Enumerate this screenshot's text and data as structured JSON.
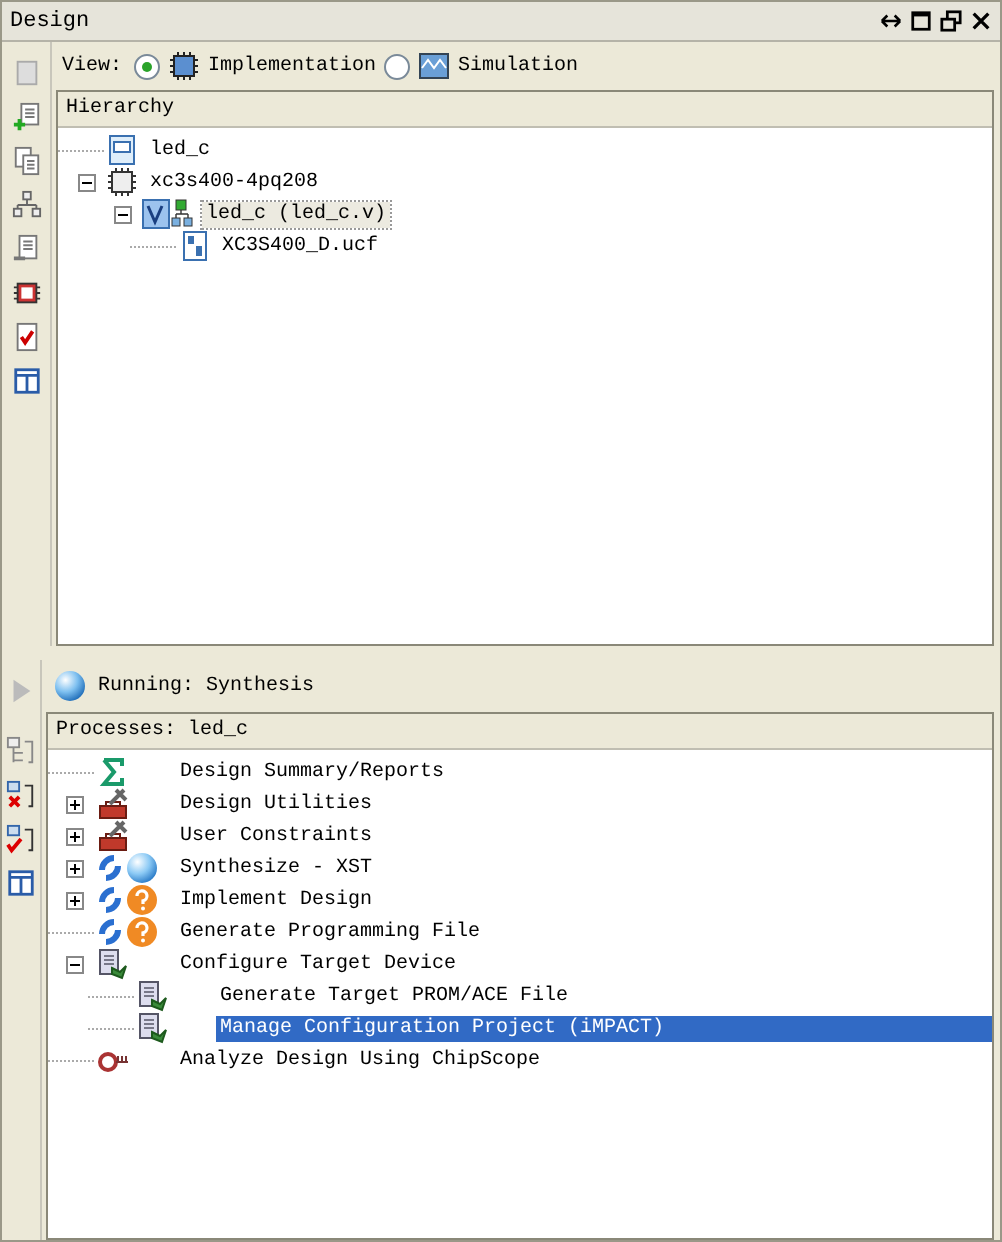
{
  "panel": {
    "title": "Design"
  },
  "view": {
    "label": "View:",
    "options": [
      {
        "label": "Implementation",
        "kind": "implementation",
        "selected": true
      },
      {
        "label": "Simulation",
        "kind": "simulation",
        "selected": false
      }
    ]
  },
  "hierarchy": {
    "header": "Hierarchy",
    "items": [
      {
        "label": "led_c",
        "kind": "project",
        "selected": false
      },
      {
        "label": "xc3s400-4pq208",
        "kind": "chip",
        "selected": false,
        "expanded": true,
        "children": [
          {
            "label": "led_c (led_c.v)",
            "kind": "verilog",
            "selected": true,
            "expanded": true,
            "children": [
              {
                "label": "XC3S400_D.ucf",
                "kind": "constraints",
                "selected": false
              }
            ]
          }
        ]
      }
    ]
  },
  "running": {
    "text": "Running: Synthesis"
  },
  "processes": {
    "header": "Processes: led_c",
    "items": [
      {
        "label": "Design Summary/Reports",
        "kind": "summary",
        "selected": false
      },
      {
        "label": "Design Utilities",
        "kind": "tools",
        "selected": false,
        "expanded": false
      },
      {
        "label": "User Constraints",
        "kind": "tools",
        "selected": false,
        "expanded": false
      },
      {
        "label": "Synthesize - XST",
        "kind": "running",
        "selected": false,
        "expanded": false
      },
      {
        "label": "Implement Design",
        "kind": "outdated",
        "selected": false,
        "expanded": false
      },
      {
        "label": "Generate Programming File",
        "kind": "outdated",
        "selected": false
      },
      {
        "label": "Configure Target Device",
        "kind": "configure",
        "selected": false,
        "expanded": true,
        "children": [
          {
            "label": "Generate Target PROM/ACE File",
            "kind": "configure",
            "selected": false
          },
          {
            "label": "Manage Configuration Project (iMPACT)",
            "kind": "configure",
            "selected": true
          }
        ]
      },
      {
        "label": "Analyze Design Using ChipScope",
        "kind": "chipscope",
        "selected": false
      }
    ]
  }
}
